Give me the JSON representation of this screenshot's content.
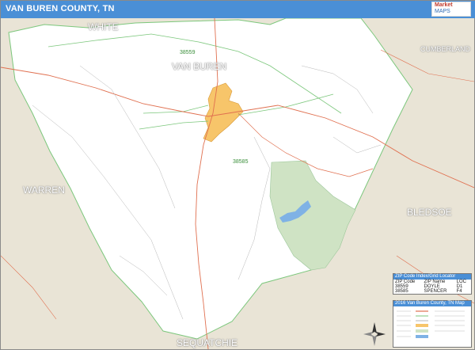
{
  "title": "VAN BUREN COUNTY, TN",
  "logo": {
    "line1": "Market",
    "line2": "MAPS"
  },
  "neighbors": [
    {
      "label": "WHITE"
    },
    {
      "label": "CUMBERLAND"
    },
    {
      "label": "WARREN"
    },
    {
      "label": "BLEDSOE"
    },
    {
      "label": "SEQUATCHIE"
    }
  ],
  "county_label": "VAN BUREN",
  "zip_labels": [
    "38559",
    "38585"
  ],
  "zip_legend": {
    "header": "ZIP Code Index/Grid Locator",
    "columns": [
      "ZIP Code",
      "ZIP Name",
      "LOC"
    ],
    "rows": [
      [
        "38559",
        "DOYLE",
        "D1"
      ],
      [
        "38585",
        "SPENCER",
        "F4"
      ]
    ]
  },
  "map_legend": {
    "header": "2016 Van Buren County, TN Map"
  },
  "colors": {
    "titlebar": "#4a8fd6",
    "county_fill": "#ffffff",
    "neighbor_fill": "#e9e4d6",
    "city_fill": "#f7c56a",
    "park_fill": "#cfe3c4",
    "zip_boundary": "#7cc77c",
    "highway": "#e07050",
    "water": "#7fb2e5"
  }
}
